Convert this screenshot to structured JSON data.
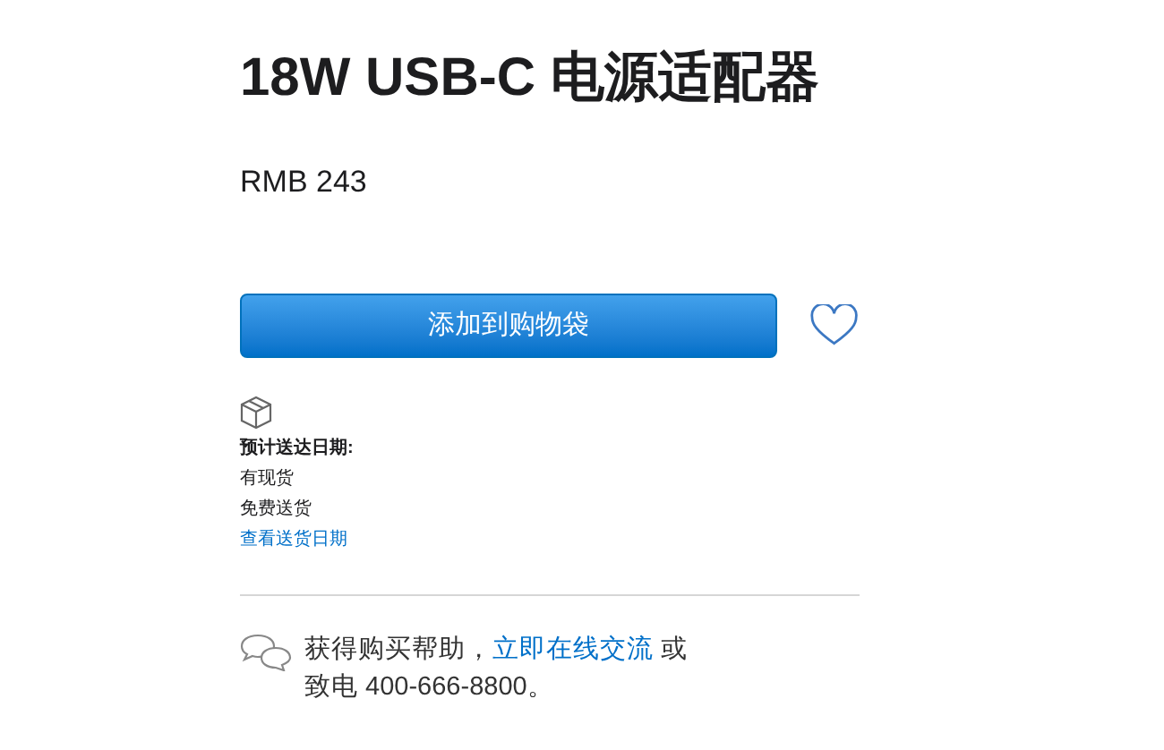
{
  "product": {
    "title": "18W USB-C 电源适配器",
    "price": "RMB 243"
  },
  "actions": {
    "add_to_bag": "添加到购物袋",
    "favorited": false
  },
  "delivery": {
    "heading": "预计送达日期:",
    "lines": [
      "有现货",
      "免费送货"
    ],
    "link": "查看送货日期"
  },
  "help": {
    "prefix": "获得购买帮助，",
    "link": "立即在线交流",
    "suffix": " 或致电 400-666-8800。"
  }
}
